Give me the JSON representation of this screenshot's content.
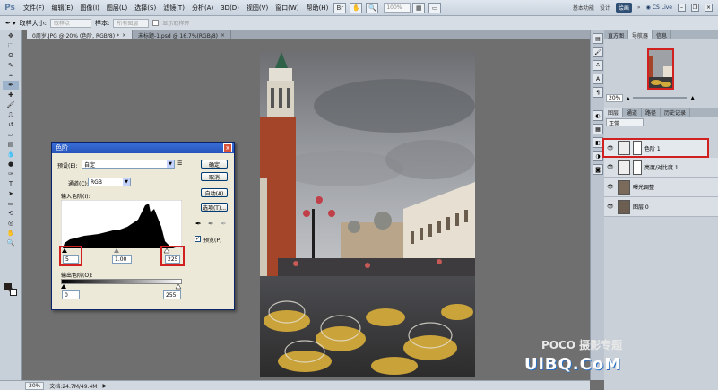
{
  "app": {
    "logo": "Ps",
    "menu": [
      "文件(F)",
      "编辑(E)",
      "图像(I)",
      "图层(L)",
      "选择(S)",
      "滤镜(T)",
      "分析(A)",
      "3D(D)",
      "视图(V)",
      "窗口(W)",
      "帮助(H)"
    ],
    "zoom_select": "100%",
    "workspaces": [
      "基本功能",
      "设计",
      "绘画"
    ],
    "cs_live": "CS Live"
  },
  "options": {
    "sample_size_label": "取样大小:",
    "sample_size_value": "取样点",
    "sample_label": "样本:",
    "sample_value": "所有图层",
    "show_ring": "显示取样环"
  },
  "tabs": [
    {
      "label": "0周岁.JPG @ 20% (色阶, RGB/8) *"
    },
    {
      "label": "未标题-1.psd @ 16.7%(RGB/8)"
    }
  ],
  "status": {
    "zoom": "20%",
    "doc": "文档:24.7M/49.4M"
  },
  "dialog": {
    "title": "色阶",
    "preset_label": "预设(E):",
    "preset_value": "自定",
    "channel_label": "通道(C):",
    "channel_value": "RGB",
    "input_label": "输入色阶(I):",
    "input_black": "5",
    "input_mid": "1.00",
    "input_white": "225",
    "output_label": "输出色阶(O):",
    "output_black": "0",
    "output_white": "255",
    "buttons": {
      "ok": "确定",
      "cancel": "取消",
      "auto": "自动(A)",
      "options": "选项(T)..."
    },
    "preview_label": "预览(P)",
    "close": "x"
  },
  "panels": {
    "nav_tabs": [
      "直方图",
      "导航器",
      "信息"
    ],
    "nav_zoom": "20%",
    "layer_tabs": [
      "图层",
      "通道",
      "路径",
      "历史记录"
    ],
    "blend_mode": "正常",
    "layers": [
      {
        "name": "色阶 1",
        "selected": true
      },
      {
        "name": "亮度/对比度 1",
        "selected": false
      },
      {
        "name": "曝光调整",
        "selected": false
      },
      {
        "name": "图层 0",
        "selected": false
      }
    ]
  },
  "watermark": {
    "brand": "POCO 摄影专题",
    "site": "UiBQ.CoM"
  },
  "colors": {
    "highlight_red": "#d02020",
    "titlebar_blue": "#2654b8"
  }
}
